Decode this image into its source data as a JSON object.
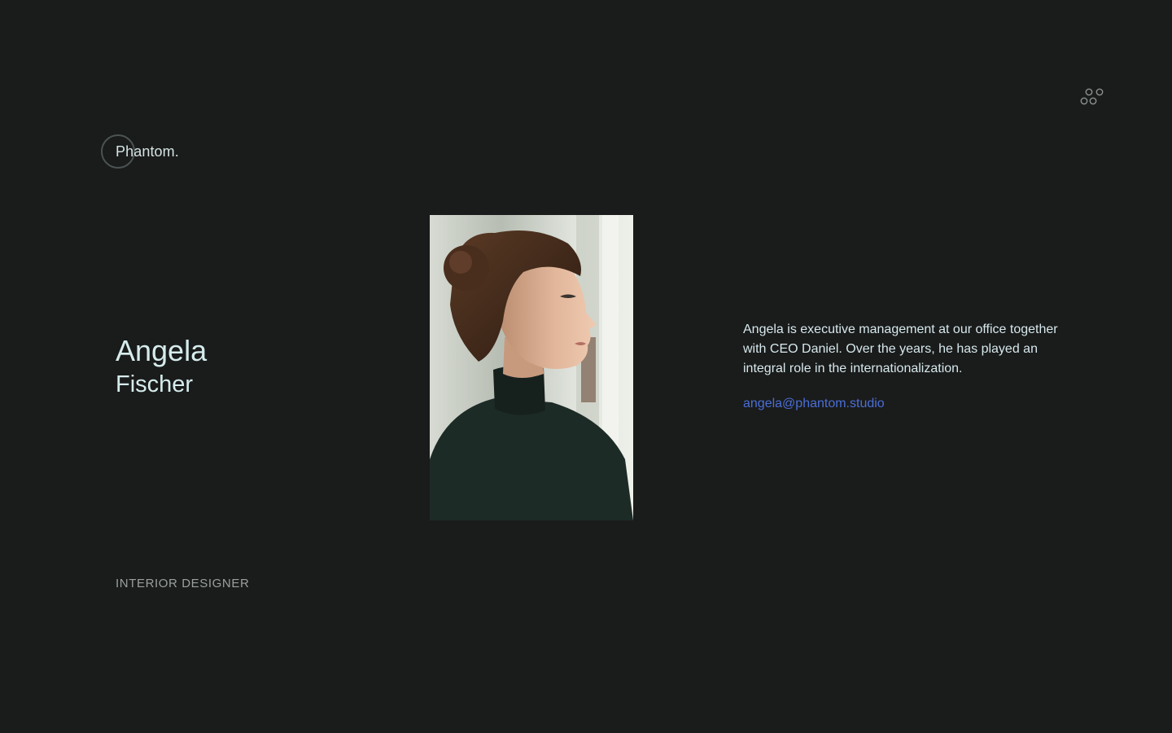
{
  "brand": {
    "logo_text": "Phantom."
  },
  "header": {
    "menu_icon": "dots-grid-icon"
  },
  "profile": {
    "first_name": "Angela",
    "last_name": "Fischer",
    "role": "INTERIOR DESIGNER",
    "bio": "Angela is executive management at our office together with CEO Daniel. Over the years, he has played an integral role in the internationalization.",
    "email": "angela@phantom.studio"
  },
  "colors": {
    "background": "#1a1b1b",
    "text": "#d6e8ec",
    "accent_link": "#4a6fd6",
    "muted": "#9aa09f"
  }
}
